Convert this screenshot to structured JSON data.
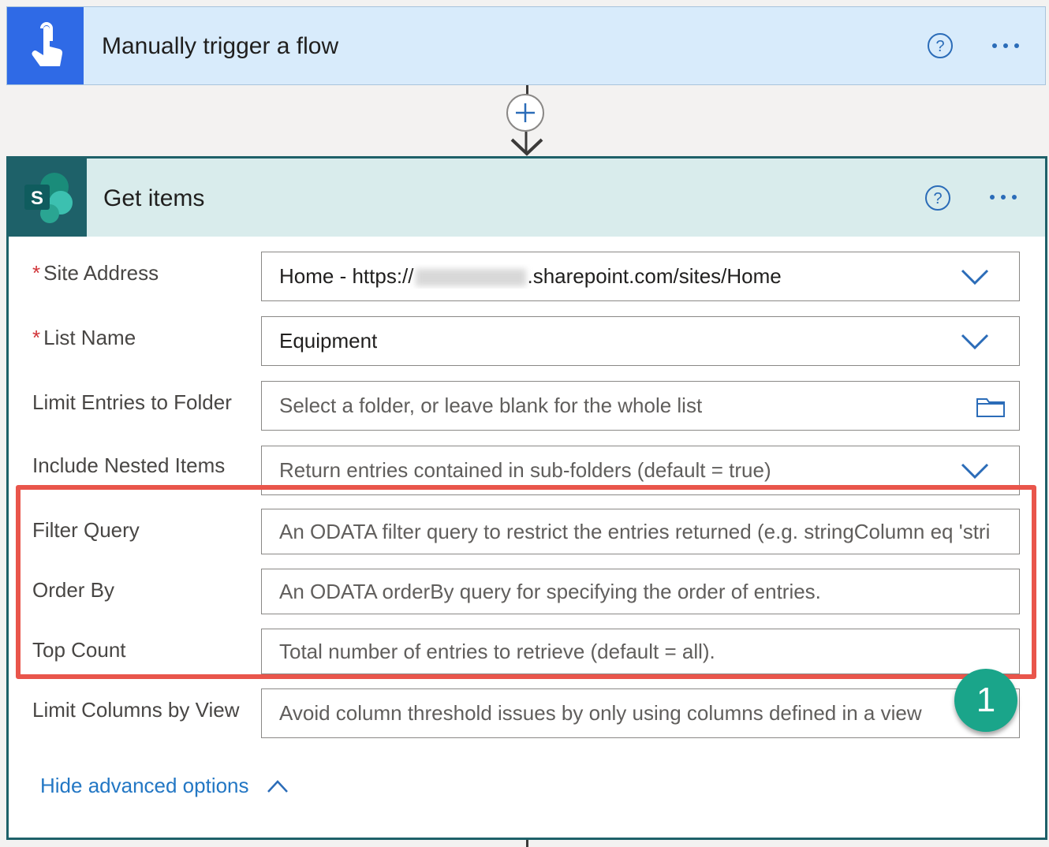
{
  "trigger": {
    "title": "Manually trigger a flow",
    "icon": "hand-touch-icon",
    "accent": "#2f6ae6"
  },
  "connector": {
    "add_icon": "plus-icon"
  },
  "action": {
    "title": "Get items",
    "icon": "sharepoint-icon",
    "icon_letter": "S",
    "accent": "#1e6169",
    "fields": {
      "site_address": {
        "label": "Site Address",
        "required": "*",
        "value_prefix": "Home - https://",
        "value_suffix": ".sharepoint.com/sites/Home"
      },
      "list_name": {
        "label": "List Name",
        "required": "*",
        "value": "Equipment"
      },
      "limit_folder": {
        "label": "Limit Entries to Folder",
        "placeholder": "Select a folder, or leave blank for the whole list"
      },
      "nested_items": {
        "label": "Include Nested Items",
        "placeholder": "Return entries contained in sub-folders (default = true)"
      },
      "filter_query": {
        "label": "Filter Query",
        "placeholder": "An ODATA filter query to restrict the entries returned (e.g. stringColumn eq 'stri"
      },
      "order_by": {
        "label": "Order By",
        "placeholder": "An ODATA orderBy query for specifying the order of entries."
      },
      "top_count": {
        "label": "Top Count",
        "placeholder": "Total number of entries to retrieve (default = all)."
      },
      "limit_columns": {
        "label": "Limit Columns by View",
        "placeholder": "Avoid column threshold issues by only using columns defined in a view"
      }
    },
    "hide_advanced": "Hide advanced options"
  },
  "annotation": {
    "badge": "1",
    "highlight_color": "#e9554b",
    "badge_color": "#1aa58a"
  }
}
